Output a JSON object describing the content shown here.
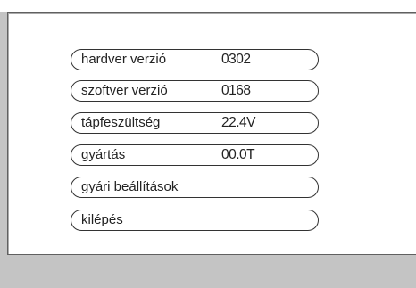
{
  "menu": {
    "items": [
      {
        "label": "hardver verzió",
        "value": "0302"
      },
      {
        "label": "szoftver verzió",
        "value": "0168"
      },
      {
        "label": "tápfeszültség",
        "value": "22.4V"
      },
      {
        "label": "gyártás",
        "value": "00.0T"
      },
      {
        "label": "gyári beállítások"
      },
      {
        "label": "kilépés"
      }
    ]
  },
  "colors": {
    "background": "#c4c4c4",
    "panel": "#ffffff",
    "border": "#333333",
    "text": "#222222"
  }
}
